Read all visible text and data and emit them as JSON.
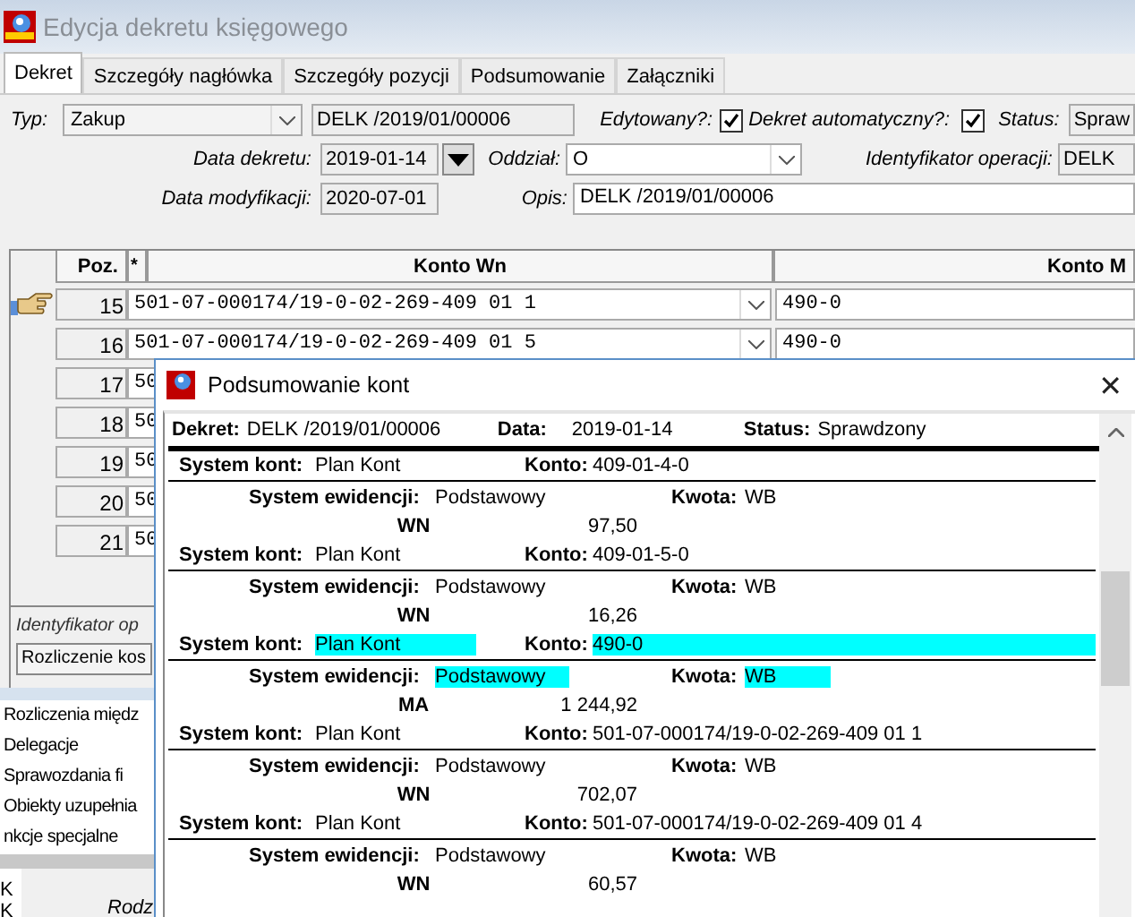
{
  "window": {
    "title": "Edycja dekretu księgowego"
  },
  "tabs": [
    {
      "label": "Dekret",
      "selected": true
    },
    {
      "label": "Szczegóły nagłówka",
      "selected": false
    },
    {
      "label": "Szczegóły pozycji",
      "selected": false
    },
    {
      "label": "Podsumowanie",
      "selected": false
    },
    {
      "label": "Załączniki",
      "selected": false
    }
  ],
  "form": {
    "typ_label": "Typ:",
    "typ": "Zakup",
    "number": "DELK /2019/01/00006",
    "edytowany_label": "Edytowany?:",
    "edytowany_checked": true,
    "automatyczny_label": "Dekret automatyczny?:",
    "automatyczny_checked": true,
    "status_label": "Status:",
    "status": "Spraw",
    "data_label": "Data dekretu:",
    "data": "2019-01-14",
    "oddzial_label": "Oddział:",
    "oddzial": "O",
    "identyfikator_label": "Identyfikator operacji:",
    "identyfikator": "DELK",
    "modyfikacja_label": "Data modyfikacji:",
    "modyfikacja": "2020-07-01",
    "opis_label": "Opis:",
    "opis": "DELK /2019/01/00006"
  },
  "grid": {
    "columns": [
      "Poz.",
      "*",
      "Konto Wn",
      "Konto M"
    ],
    "rows": [
      {
        "poz": "15",
        "konto_wn": "501-07-000174/19-0-02-269-409 01 1",
        "konto_ma": "490-0",
        "selected": true
      },
      {
        "poz": "16",
        "konto_wn": "501-07-000174/19-0-02-269-409 01 5",
        "konto_ma": "490-0",
        "selected": false
      },
      {
        "poz": "17",
        "konto_wn": "50",
        "selected": false
      },
      {
        "poz": "18",
        "konto_wn": "50",
        "selected": false
      },
      {
        "poz": "19",
        "konto_wn": "50",
        "selected": false
      },
      {
        "poz": "20",
        "konto_wn": "50",
        "selected": false
      },
      {
        "poz": "21",
        "konto_wn": "50",
        "selected": false
      }
    ]
  },
  "lower": {
    "identyfikator_label": "Identyfikator op",
    "rozliczenie": "Rozliczenie kos",
    "menu": [
      "Rozliczenia międz",
      "Delegacje",
      "Sprawozdania fi",
      "Obiekty uzupełnia",
      "nkcje specjalne"
    ],
    "side_items": [
      "K",
      "K"
    ],
    "rodz_label": "Rodz"
  },
  "dialog": {
    "title": "Podsumowanie kont",
    "close": "✕",
    "header": [
      {
        "label": "Dekret:",
        "value": "DELK /2019/01/00006"
      },
      {
        "label": "Data:",
        "value": "2019-01-14"
      },
      {
        "label": "Status:",
        "value": "Sprawdzony"
      }
    ],
    "groups": [
      {
        "system_kont_label": "System kont:",
        "system_kont": "Plan Kont",
        "konto_label": "Konto:",
        "konto": "409-01-4-0",
        "ewidencja_label": "System ewidencji:",
        "ewidencja": "Podstawowy",
        "kwota_label": "Kwota:",
        "kwota": "WB",
        "side": "WN",
        "amount": "97,50",
        "selected": false
      },
      {
        "system_kont_label": "System kont:",
        "system_kont": "Plan Kont",
        "konto_label": "Konto:",
        "konto": "409-01-5-0",
        "ewidencja_label": "System ewidencji:",
        "ewidencja": "Podstawowy",
        "kwota_label": "Kwota:",
        "kwota": "WB",
        "side": "WN",
        "amount": "16,26",
        "selected": false
      },
      {
        "system_kont_label": "System kont:",
        "system_kont": "Plan Kont",
        "konto_label": "Konto:",
        "konto": "490-0",
        "ewidencja_label": "System ewidencji:",
        "ewidencja": "Podstawowy",
        "kwota_label": "Kwota:",
        "kwota": "WB",
        "side": "MA",
        "amount": "1 244,92",
        "selected": true
      },
      {
        "system_kont_label": "System kont:",
        "system_kont": "Plan Kont",
        "konto_label": "Konto:",
        "konto": "501-07-000174/19-0-02-269-409 01 1",
        "ewidencja_label": "System ewidencji:",
        "ewidencja": "Podstawowy",
        "kwota_label": "Kwota:",
        "kwota": "WB",
        "side": "WN",
        "amount": "702,07",
        "selected": false
      },
      {
        "system_kont_label": "System kont:",
        "system_kont": "Plan Kont",
        "konto_label": "Konto:",
        "konto": "501-07-000174/19-0-02-269-409 01 4",
        "ewidencja_label": "System ewidencji:",
        "ewidencja": "Podstawowy",
        "kwota_label": "Kwota:",
        "kwota": "WB",
        "side": "WN",
        "amount": "60,57",
        "selected": false
      }
    ]
  }
}
